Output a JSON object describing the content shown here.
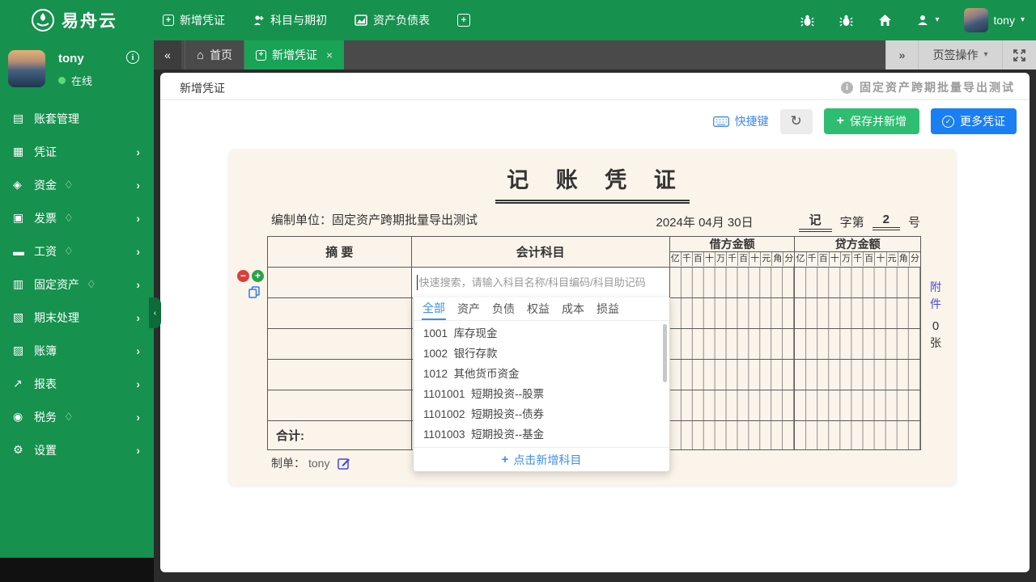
{
  "brand": {
    "name": "易舟云"
  },
  "topnav": {
    "items": [
      {
        "label": "新增凭证",
        "icon": "plus-square-icon"
      },
      {
        "label": "科目与期初",
        "icon": "subjects-icon"
      },
      {
        "label": "资产负债表",
        "icon": "balance-sheet-icon"
      },
      {
        "label": "",
        "icon": "grid-plus-icon"
      }
    ],
    "right": {
      "username": "tony"
    }
  },
  "sidebar": {
    "user": {
      "name": "tony",
      "status": "在线"
    },
    "items": [
      {
        "label": "账套管理",
        "icon": "account-set-icon",
        "premium": false,
        "expandable": false
      },
      {
        "label": "凭证",
        "icon": "voucher-icon",
        "premium": false,
        "expandable": true
      },
      {
        "label": "资金",
        "icon": "funds-icon",
        "premium": true,
        "expandable": true
      },
      {
        "label": "发票",
        "icon": "invoice-icon",
        "premium": true,
        "expandable": true
      },
      {
        "label": "工资",
        "icon": "payroll-icon",
        "premium": true,
        "expandable": true
      },
      {
        "label": "固定资产",
        "icon": "fixed-assets-icon",
        "premium": true,
        "expandable": true
      },
      {
        "label": "期末处理",
        "icon": "period-end-icon",
        "premium": false,
        "expandable": true
      },
      {
        "label": "账簿",
        "icon": "ledger-icon",
        "premium": false,
        "expandable": true
      },
      {
        "label": "报表",
        "icon": "reports-icon",
        "premium": false,
        "expandable": true
      },
      {
        "label": "税务",
        "icon": "tax-icon",
        "premium": true,
        "expandable": true
      },
      {
        "label": "设置",
        "icon": "settings-icon",
        "premium": false,
        "expandable": true
      }
    ]
  },
  "tabbar": {
    "home_tab": "首页",
    "active_tab": "新增凭证",
    "actions_label": "页签操作"
  },
  "page": {
    "title": "新增凭证",
    "watermark": "固定资产跨期批量导出测试",
    "toolbar": {
      "shortcut": "快捷键",
      "save_and_new": "保存并新增",
      "more_vouchers": "更多凭证"
    }
  },
  "voucher": {
    "title": "记 账 凭 证",
    "unit_label": "编制单位：",
    "unit": "固定资产跨期批量导出测试",
    "date": "2024年 04月 30日",
    "word": "记",
    "word_mid": "字第",
    "number": "2",
    "word_end": "号",
    "table": {
      "summary": "摘 要",
      "account": "会计科目",
      "debit": "借方金额",
      "credit": "贷方金额",
      "digits": [
        "亿",
        "千",
        "百",
        "十",
        "万",
        "千",
        "百",
        "十",
        "元",
        "角",
        "分"
      ],
      "total": "合计:",
      "search_placeholder": "快速搜索，请输入科目名称/科目编码/科目助记码"
    },
    "attachment": {
      "char1": "附",
      "char2": "件",
      "count": "0",
      "unit": "张"
    },
    "preparer_label": "制单：",
    "preparer_name": "tony"
  },
  "dropdown": {
    "tabs": [
      "全部",
      "资产",
      "负债",
      "权益",
      "成本",
      "损益"
    ],
    "items": [
      {
        "code": "1001",
        "name": "库存现金"
      },
      {
        "code": "1002",
        "name": "银行存款"
      },
      {
        "code": "1012",
        "name": "其他货币资金"
      },
      {
        "code": "1101001",
        "name": "短期投资--股票"
      },
      {
        "code": "1101002",
        "name": "短期投资--债券"
      },
      {
        "code": "1101003",
        "name": "短期投资--基金"
      }
    ],
    "add_label": "点击新增科目"
  },
  "colors": {
    "header_green": "#16914e",
    "active_tab_green": "#18a356",
    "save_button_green": "#2ebd71",
    "more_button_blue": "#1a7ff2",
    "link_blue": "#3f88f7",
    "voucher_paper": "#fbf4ea",
    "attachment_blue": "#4646e0"
  }
}
